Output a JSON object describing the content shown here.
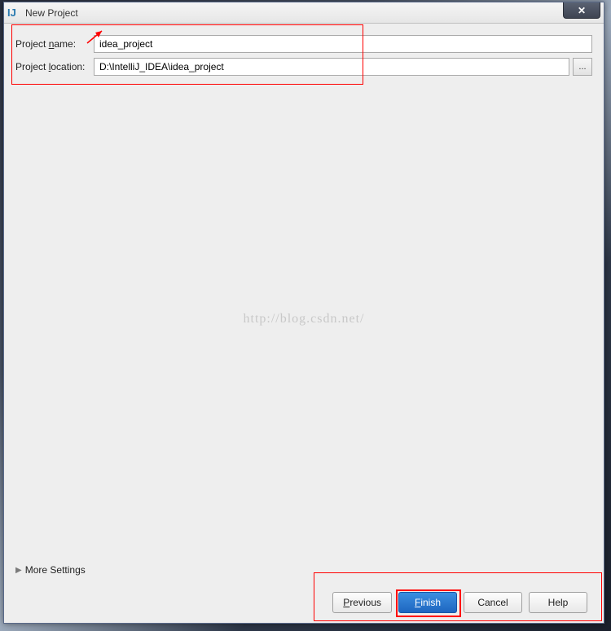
{
  "window": {
    "title": "New Project",
    "icon_label": "IJ"
  },
  "form": {
    "project_name_label": "Project name:",
    "project_name_value": "idea_project",
    "project_location_label": "Project location:",
    "project_location_value": "D:\\IntelliJ_IDEA\\idea_project",
    "browse_label": "..."
  },
  "watermark": "http://blog.csdn.net/",
  "more_settings_label": "More Settings",
  "buttons": {
    "previous": "Previous",
    "finish": "Finish",
    "cancel": "Cancel",
    "help": "Help"
  }
}
